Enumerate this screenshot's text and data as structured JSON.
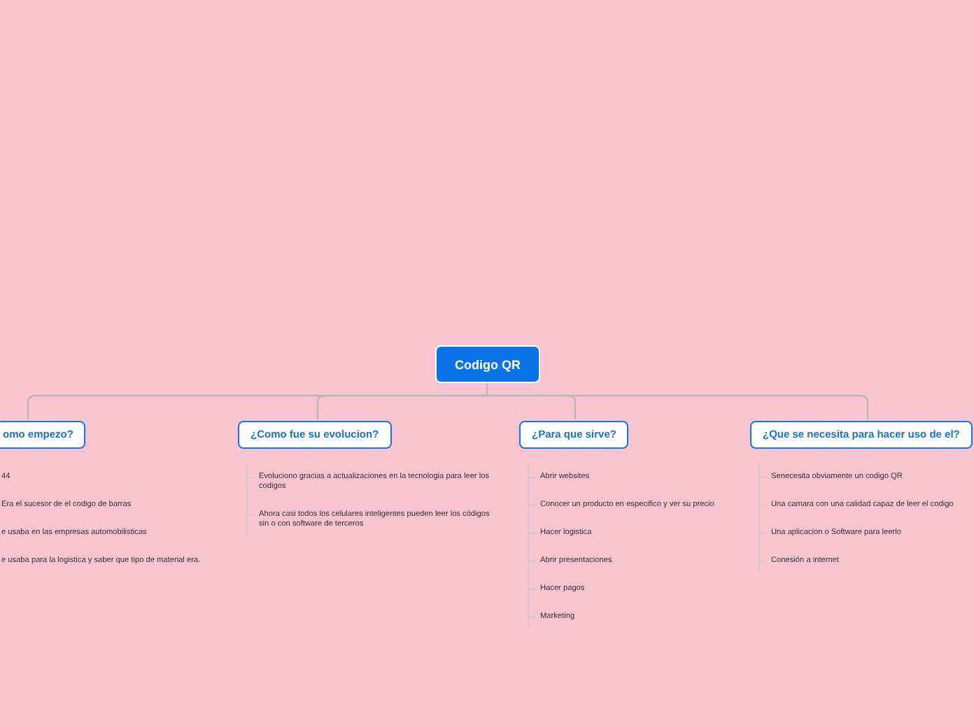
{
  "root": {
    "label": "Codigo QR"
  },
  "branches": [
    {
      "label": "omo empezo?",
      "children": [
        "44",
        "Era el sucesor de el codigo de barras",
        "e usaba en las empresas automobilisticas",
        "e usaba para la logistica y saber que tipo de material era."
      ]
    },
    {
      "label": "¿Como fue su evolucion?",
      "children": [
        "Evoluciono gracias a actualizaciones en la tecnologia para leer los codigos",
        "Ahora casi todos los celulares inteligentes pueden leer los códigos sin o con software de terceros"
      ]
    },
    {
      "label": "¿Para que sirve?",
      "children": [
        "Abrir websites",
        "Conocer un producto en especifico y ver su precio",
        "Hacer logistica",
        "Abrir presentaciones",
        "Hacer pagos",
        "Marketing"
      ]
    },
    {
      "label": "¿Que se necesita para hacer uso de el?",
      "children": [
        "Senecesita obviamente un codigo QR",
        "Una camara con una calidad capaz de leer el codigo",
        "Una aplicacion o Software para leerlo",
        "Conesión a internet"
      ]
    }
  ]
}
